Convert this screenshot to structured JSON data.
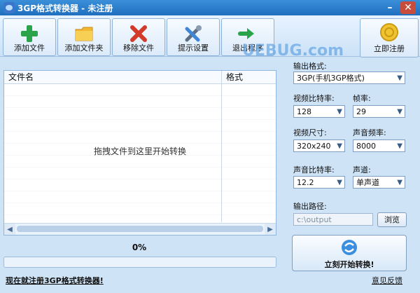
{
  "window": {
    "title": "3GP格式转换器 - 未注册"
  },
  "toolbar": {
    "buttons": [
      {
        "label": "添加文件",
        "icon": "plus-icon"
      },
      {
        "label": "添加文件夹",
        "icon": "folder-icon"
      },
      {
        "label": "移除文件",
        "icon": "close-icon"
      },
      {
        "label": "提示设置",
        "icon": "tools-icon"
      },
      {
        "label": "退出程序",
        "icon": "exit-icon"
      }
    ],
    "register": {
      "label": "立即注册",
      "icon": "coin-icon"
    }
  },
  "file_list": {
    "columns": [
      "文件名",
      "格式"
    ],
    "hint": "拖拽文件到这里开始转换"
  },
  "progress": {
    "percent": "0%",
    "fill_fraction": 0
  },
  "settings": {
    "output_format": {
      "label": "输出格式:",
      "value": "3GP(手机3GP格式)"
    },
    "video_bitrate": {
      "label": "视频比特率:",
      "value": "128"
    },
    "frame_rate": {
      "label": "帧率:",
      "value": "29"
    },
    "video_size": {
      "label": "视频尺寸:",
      "value": "320x240"
    },
    "audio_rate": {
      "label": "声音频率:",
      "value": "8000"
    },
    "audio_bitrate": {
      "label": "声音比特率:",
      "value": "12.2"
    },
    "channel": {
      "label": "声道:",
      "value": "单声道"
    },
    "output_path": {
      "label": "输出路径:",
      "value": "c:\\output"
    },
    "browse_label": "浏览"
  },
  "start_button": {
    "label": "立刻开始转换!"
  },
  "footer": {
    "register_link": "现在就注册3GP格式转换器!",
    "feedback_link": "意见反馈"
  },
  "watermark": "UEBUG.com"
}
